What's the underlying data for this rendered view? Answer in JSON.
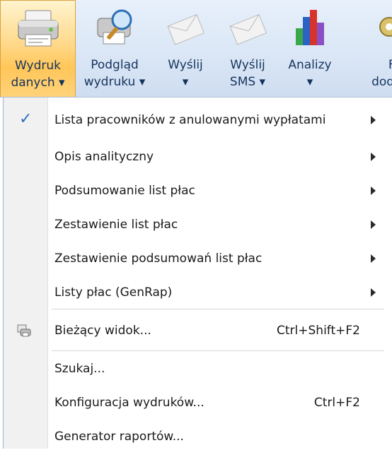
{
  "ribbon": {
    "buttons": [
      {
        "line1": "Wydruk",
        "line2": "danych ▾",
        "icon": "printer-icon"
      },
      {
        "line1": "Podgląd",
        "line2": "wydruku ▾",
        "icon": "print-preview-icon"
      },
      {
        "line1": "Wyślij",
        "line2": "▾",
        "icon": "send-envelope-icon"
      },
      {
        "line1": "Wyślij",
        "line2": "SMS ▾",
        "icon": "sms-envelope-icon"
      },
      {
        "line1": "Analizy",
        "line2": "▾",
        "icon": "bar-chart-icon"
      },
      {
        "line1": "Funl",
        "line2": "dodatk",
        "icon": "gear-icon"
      }
    ]
  },
  "menu": {
    "items": [
      {
        "label": "Lista pracowników z anulowanymi wypłatami",
        "checked": true,
        "submenu": true
      },
      {
        "label": "Opis analityczny",
        "submenu": true
      },
      {
        "label": "Podsumowanie list płac",
        "submenu": true
      },
      {
        "label": "Zestawienie list płac",
        "submenu": true
      },
      {
        "label": "Zestawienie podsumowań list płac",
        "submenu": true
      },
      {
        "label": "Listy płac (GenRap)",
        "submenu": true
      },
      {
        "label": "Bieżący widok...",
        "shortcut": "Ctrl+Shift+F2",
        "icon": "current-view-icon"
      },
      {
        "label": "Szukaj..."
      },
      {
        "label": "Konfiguracja wydruków...",
        "shortcut": "Ctrl+F2"
      },
      {
        "label": "Generator raportów..."
      }
    ]
  },
  "colors": {
    "accent_check": "#2f6fbf",
    "active_button": "#ffc659",
    "ribbon_bg": "#dbe7f6"
  }
}
